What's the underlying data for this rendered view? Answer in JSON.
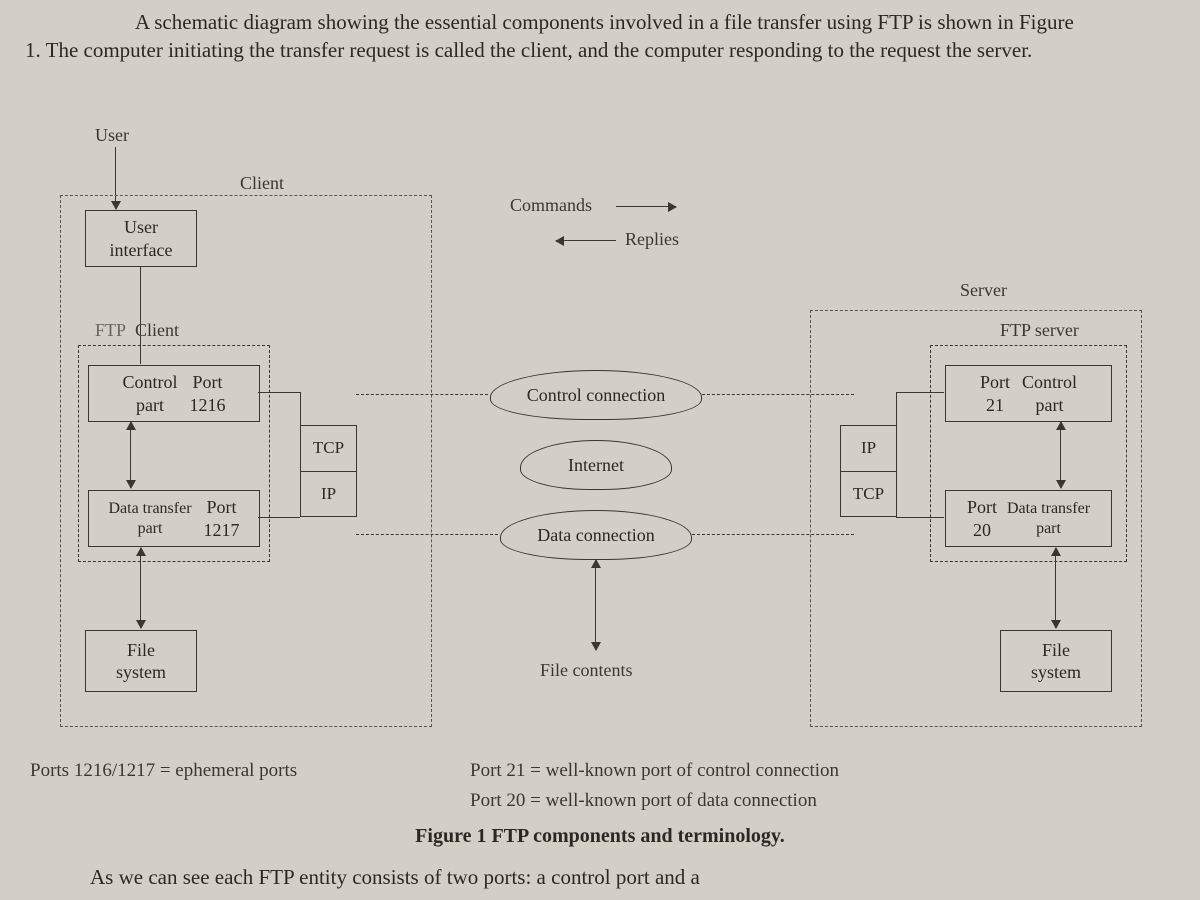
{
  "paragraph": "A schematic diagram showing the essential components involved in a file transfer using FTP is shown in Figure 1. The computer initiating the transfer request is called the client, and the computer responding to the request the server.",
  "labels": {
    "user": "User",
    "client": "Client",
    "server": "Server",
    "commands": "Commands",
    "replies": "Replies",
    "ftp_client": "FTP Client",
    "ftp_server": "FTP server",
    "control_conn": "Control connection",
    "internet": "Internet",
    "data_conn": "Data connection",
    "file_contents": "File contents",
    "tcp": "TCP",
    "ip": "IP"
  },
  "client_boxes": {
    "user_interface": "User\ninterface",
    "control_part": "Control part",
    "control_port": "Port 1216",
    "data_part": "Data transfer part",
    "data_port": "Port 1217",
    "file_system": "File\nsystem"
  },
  "server_boxes": {
    "control_part": "Control part",
    "control_port": "Port 21",
    "data_part": "Data transfer part",
    "data_port": "Port 20",
    "file_system": "File\nsystem"
  },
  "legend": {
    "left": "Ports 1216/1217 = ephemeral ports",
    "right1": "Port 21 = well-known port of control connection",
    "right2": "Port 20 = well-known port of data connection"
  },
  "caption": "Figure 1 FTP components and terminology.",
  "trailing": "As we can see  each FTP entity consists of two ports:  a control port and a"
}
